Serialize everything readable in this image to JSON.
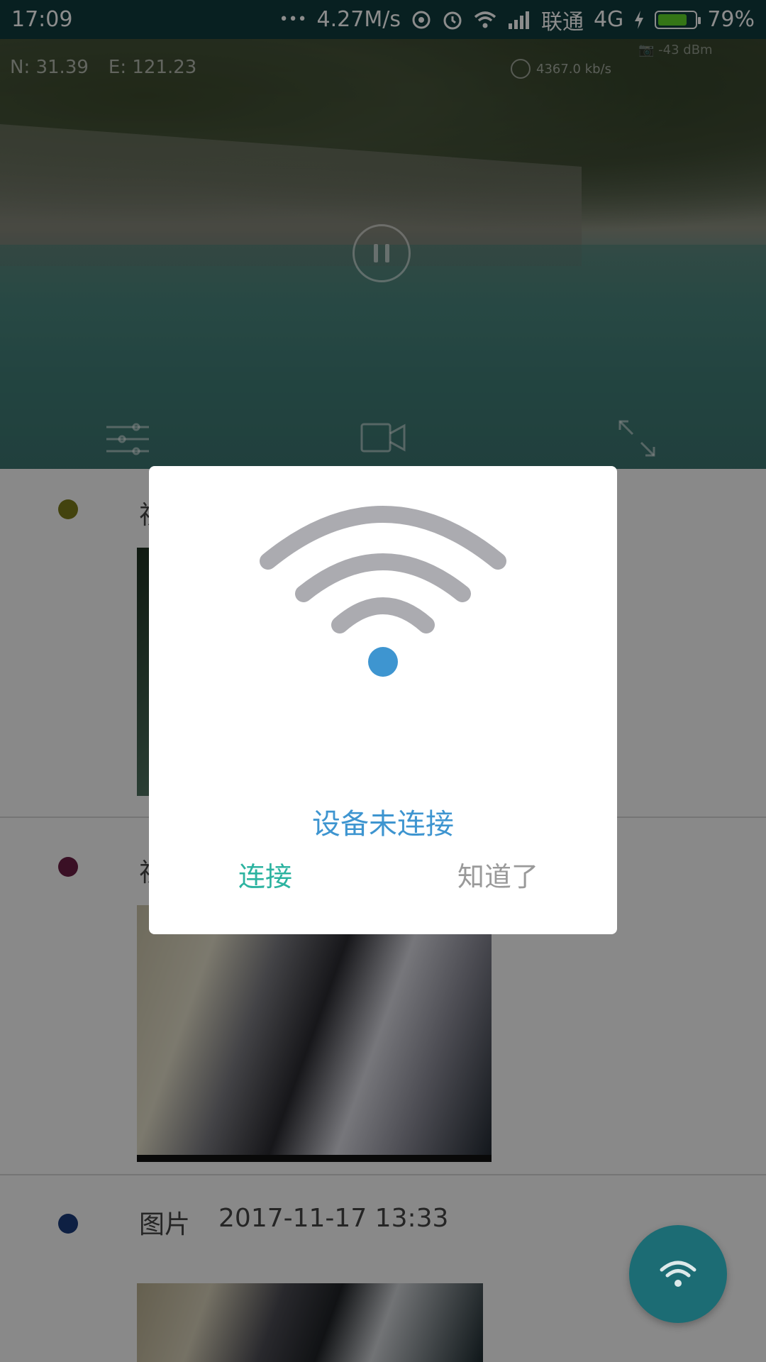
{
  "status_bar": {
    "time": "17:09",
    "dots": "•••",
    "net_speed": "4.27M/s",
    "carrier": "联通",
    "network": "4G",
    "battery": "79%",
    "battery_level": 0.79,
    "icons": [
      "hotspot-icon",
      "alarm-icon",
      "wifi-icon",
      "cell-signal-icon",
      "charging-icon",
      "battery-icon"
    ]
  },
  "video": {
    "coord_n": "N: 31.39",
    "coord_e": "E: 121.23",
    "bitrate": "4367.0 kb/s",
    "signal": "-43 dBm",
    "controls": [
      "settings-sliders-icon",
      "record-video-icon",
      "fullscreen-icon"
    ]
  },
  "list": {
    "entries": [
      {
        "type_label": "视",
        "date": "",
        "dot_color": "#7a7a1a"
      },
      {
        "type_label": "视",
        "date": "",
        "dot_color": "#6a1e44"
      },
      {
        "type_label": "图片",
        "date": "2017-11-17 13:33",
        "dot_color": "#1b3b7a"
      }
    ]
  },
  "dialog": {
    "message": "设备未连接",
    "connect_label": "连接",
    "ok_label": "知道了",
    "accent": "#3e95d0",
    "icon": "wifi-icon"
  },
  "fab": {
    "icon": "wifi-icon"
  }
}
